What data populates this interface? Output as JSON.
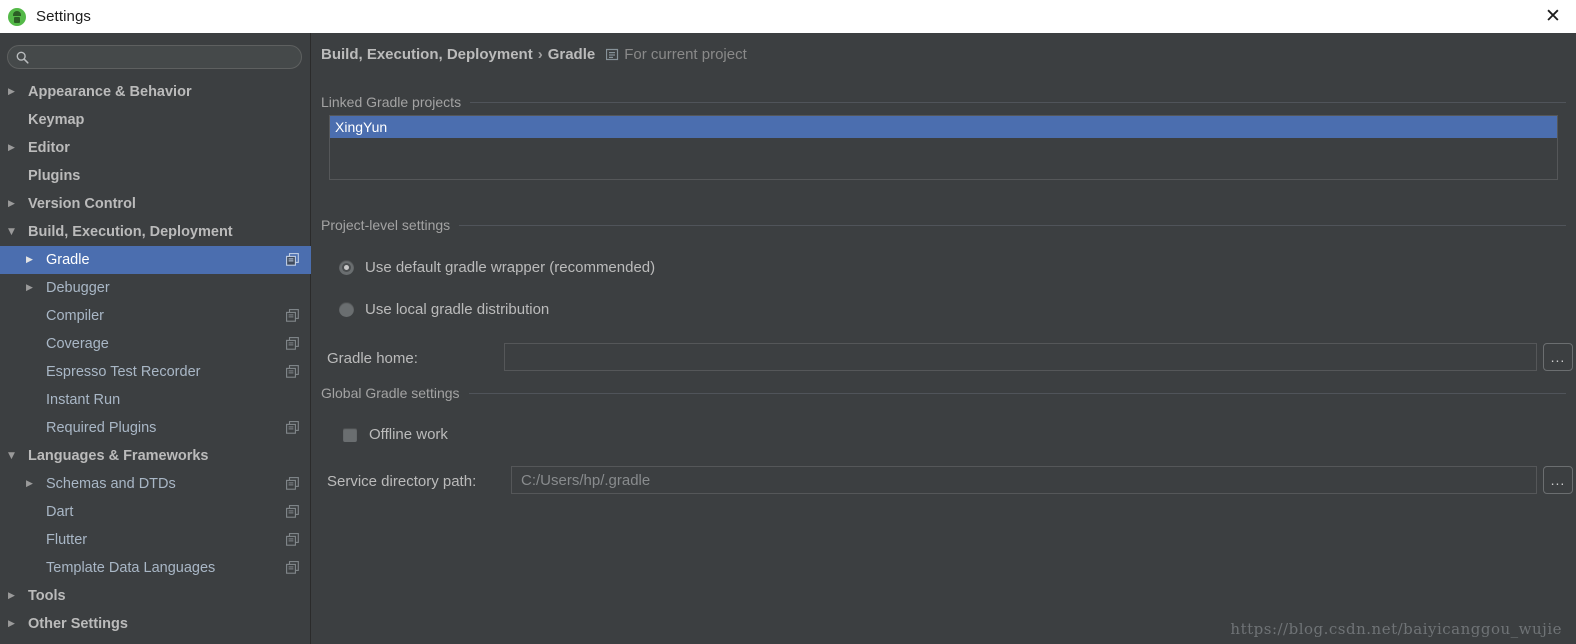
{
  "window": {
    "title": "Settings",
    "app_icon": "android-studio-icon",
    "close_label": "✕"
  },
  "search": {
    "value": "",
    "placeholder": "",
    "icon": "search-icon"
  },
  "sidebar": {
    "items": [
      {
        "label": "Appearance & Behavior",
        "level": 0,
        "arrow": "▶",
        "bold": true,
        "selected": false,
        "project_icon": false
      },
      {
        "label": "Keymap",
        "level": 0,
        "arrow": "",
        "bold": true,
        "selected": false,
        "project_icon": false
      },
      {
        "label": "Editor",
        "level": 0,
        "arrow": "▶",
        "bold": true,
        "selected": false,
        "project_icon": false
      },
      {
        "label": "Plugins",
        "level": 0,
        "arrow": "",
        "bold": true,
        "selected": false,
        "project_icon": false
      },
      {
        "label": "Version Control",
        "level": 0,
        "arrow": "▶",
        "bold": true,
        "selected": false,
        "project_icon": false
      },
      {
        "label": "Build, Execution, Deployment",
        "level": 0,
        "arrow": "▼",
        "bold": true,
        "selected": false,
        "project_icon": false
      },
      {
        "label": "Gradle",
        "level": 1,
        "arrow": "▶",
        "bold": false,
        "selected": true,
        "project_icon": true
      },
      {
        "label": "Debugger",
        "level": 1,
        "arrow": "▶",
        "bold": false,
        "selected": false,
        "project_icon": false
      },
      {
        "label": "Compiler",
        "level": 1,
        "arrow": "",
        "bold": false,
        "selected": false,
        "project_icon": true
      },
      {
        "label": "Coverage",
        "level": 1,
        "arrow": "",
        "bold": false,
        "selected": false,
        "project_icon": true
      },
      {
        "label": "Espresso Test Recorder",
        "level": 1,
        "arrow": "",
        "bold": false,
        "selected": false,
        "project_icon": true
      },
      {
        "label": "Instant Run",
        "level": 1,
        "arrow": "",
        "bold": false,
        "selected": false,
        "project_icon": false
      },
      {
        "label": "Required Plugins",
        "level": 1,
        "arrow": "",
        "bold": false,
        "selected": false,
        "project_icon": true
      },
      {
        "label": "Languages & Frameworks",
        "level": 0,
        "arrow": "▼",
        "bold": true,
        "selected": false,
        "project_icon": false
      },
      {
        "label": "Schemas and DTDs",
        "level": 1,
        "arrow": "▶",
        "bold": false,
        "selected": false,
        "project_icon": true
      },
      {
        "label": "Dart",
        "level": 1,
        "arrow": "",
        "bold": false,
        "selected": false,
        "project_icon": true
      },
      {
        "label": "Flutter",
        "level": 1,
        "arrow": "",
        "bold": false,
        "selected": false,
        "project_icon": true
      },
      {
        "label": "Template Data Languages",
        "level": 1,
        "arrow": "",
        "bold": false,
        "selected": false,
        "project_icon": true
      },
      {
        "label": "Tools",
        "level": 0,
        "arrow": "▶",
        "bold": true,
        "selected": false,
        "project_icon": false
      },
      {
        "label": "Other Settings",
        "level": 0,
        "arrow": "▶",
        "bold": true,
        "selected": false,
        "project_icon": false
      }
    ]
  },
  "breadcrumb": {
    "parent": "Build, Execution, Deployment",
    "separator": "›",
    "current": "Gradle",
    "scope_icon": "project-scope-icon",
    "scope_text": "For current project"
  },
  "main": {
    "linked_projects": {
      "header": "Linked Gradle projects",
      "items": [
        {
          "label": "XingYun",
          "selected": true
        }
      ]
    },
    "project_level": {
      "header": "Project-level settings",
      "radios": [
        {
          "label": "Use default gradle wrapper (recommended)",
          "checked": true
        },
        {
          "label": "Use local gradle distribution",
          "checked": false
        }
      ],
      "gradle_home": {
        "label": "Gradle home:",
        "value": "",
        "browse_label": "..."
      }
    },
    "global_settings": {
      "header": "Global Gradle settings",
      "offline_work": {
        "label": "Offline work",
        "checked": false
      },
      "service_directory": {
        "label": "Service directory path:",
        "value": "C:/Users/hp/.gradle",
        "browse_label": "..."
      }
    }
  },
  "watermark": {
    "text": "https://blog.csdn.net/baiyicanggou_wujie"
  },
  "colors": {
    "background": "#3c3f41",
    "titlebar": "#ffffff",
    "selection": "#4b6eaf",
    "text": "#bbbbbb",
    "muted_text": "#898989",
    "border": "#555759"
  }
}
